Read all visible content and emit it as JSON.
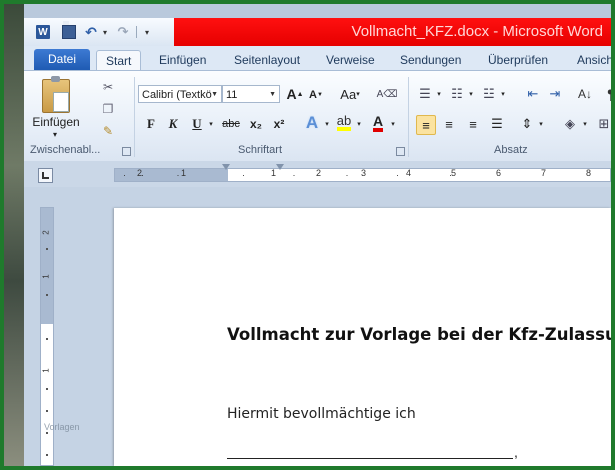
{
  "window": {
    "title": "Vollmacht_KFZ.docx - Microsoft Word"
  },
  "quick_access": {
    "app_icon": "word-logo-icon",
    "app_letter": "W",
    "icons": [
      "save-icon",
      "undo-icon",
      "redo-icon",
      "customize-dropdown-icon"
    ]
  },
  "tabs": [
    {
      "label": "Datei"
    },
    {
      "label": "Start"
    },
    {
      "label": "Einfügen"
    },
    {
      "label": "Seitenlayout"
    },
    {
      "label": "Verweise"
    },
    {
      "label": "Sendungen"
    },
    {
      "label": "Überprüfen"
    },
    {
      "label": "Ansicht"
    }
  ],
  "ribbon": {
    "clipboard": {
      "paste_label": "Einfügen",
      "group_label": "Zwischenabl..."
    },
    "font": {
      "font_name": "Calibri (Textkö",
      "font_size": "11",
      "change_case_label": "Aa",
      "bold": "F",
      "italic": "K",
      "underline": "U",
      "strikethrough": "abc",
      "subscript": "x₂",
      "superscript": "x²",
      "group_label": "Schriftart"
    },
    "paragraph": {
      "group_label": "Absatz"
    }
  },
  "ruler": {
    "numbers": [
      "2",
      "1",
      "1",
      "2",
      "3",
      "4",
      "5",
      "6",
      "7",
      "8"
    ],
    "vertical_numbers": [
      "2",
      "1",
      "1"
    ]
  },
  "document": {
    "title": "Vollmacht zur Vorlage bei der Kfz-Zulassung",
    "line1": "Hiermit bevollmächtige ich",
    "signature_comma": ","
  },
  "watermark": "Vorlagen"
}
